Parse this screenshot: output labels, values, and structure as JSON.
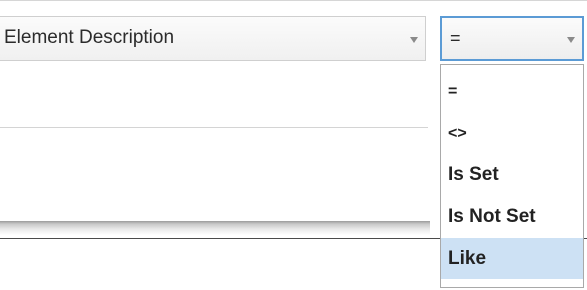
{
  "filter_row": {
    "field_combo": {
      "value": "Element Description",
      "arrow_icon": "chevron-down-icon"
    },
    "operator_combo": {
      "value": "=",
      "arrow_icon": "chevron-down-icon",
      "focus_border_color": "#5b9bd5"
    }
  },
  "operator_dropdown": {
    "items": [
      {
        "label": "="
      },
      {
        "label": "<>"
      },
      {
        "label": "Is Set"
      },
      {
        "label": "Is Not Set"
      },
      {
        "label": "Like",
        "highlighted": true
      }
    ],
    "highlight_color": "#cde1f4"
  }
}
